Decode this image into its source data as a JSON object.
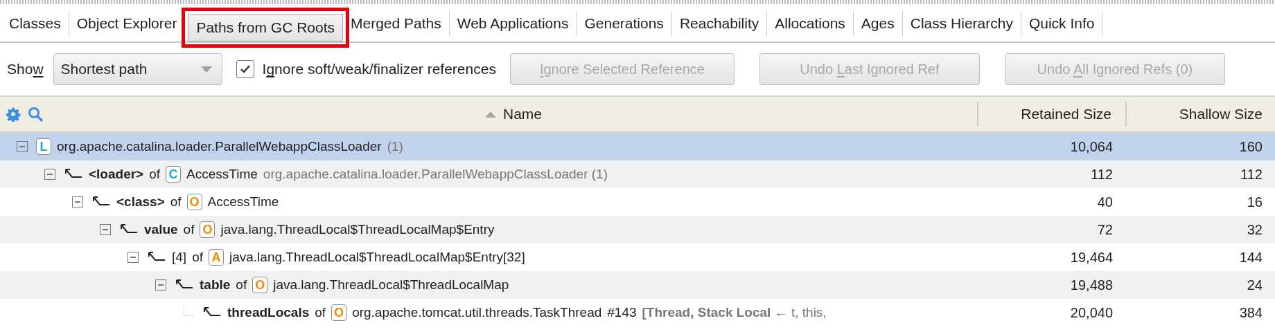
{
  "tabs": [
    {
      "label": "Classes",
      "selected": false,
      "highlighted": false
    },
    {
      "label": "Object Explorer",
      "selected": false,
      "highlighted": false
    },
    {
      "label": "Paths from GC Roots",
      "selected": true,
      "highlighted": true
    },
    {
      "label": "Merged Paths",
      "selected": false,
      "highlighted": false
    },
    {
      "label": "Web Applications",
      "selected": false,
      "highlighted": false
    },
    {
      "label": "Generations",
      "selected": false,
      "highlighted": false
    },
    {
      "label": "Reachability",
      "selected": false,
      "highlighted": false
    },
    {
      "label": "Allocations",
      "selected": false,
      "highlighted": false
    },
    {
      "label": "Ages",
      "selected": false,
      "highlighted": false
    },
    {
      "label": "Class Hierarchy",
      "selected": false,
      "highlighted": false
    },
    {
      "label": "Quick Info",
      "selected": false,
      "highlighted": false
    }
  ],
  "toolbar": {
    "show_label": [
      {
        "text": "Sho",
        "underlined": false
      },
      {
        "text": "w",
        "underlined": true
      }
    ],
    "show_dropdown": {
      "value": "Shortest path"
    },
    "ignore_checkbox": {
      "label": [
        {
          "text": "I",
          "underlined": false
        },
        {
          "text": "g",
          "underlined": true
        },
        {
          "text": "nore soft/weak/finalizer references",
          "underlined": false
        }
      ],
      "checked": true
    },
    "buttons": [
      {
        "label": [
          {
            "text": "I",
            "underlined": true
          },
          {
            "text": "gnore Selected Reference",
            "underlined": false
          }
        ],
        "disabled": true
      },
      {
        "label": [
          {
            "text": "Undo ",
            "underlined": false
          },
          {
            "text": "L",
            "underlined": true
          },
          {
            "text": "ast Ignored Ref",
            "underlined": false
          }
        ],
        "disabled": true
      },
      {
        "label": [
          {
            "text": "Undo ",
            "underlined": false
          },
          {
            "text": "A",
            "underlined": true
          },
          {
            "text": "ll Ignored Refs (0)",
            "underlined": false
          }
        ],
        "disabled": true
      }
    ]
  },
  "table": {
    "columns": [
      {
        "label": "Name",
        "sorted": true
      },
      {
        "label": "Retained Size",
        "sorted": false
      },
      {
        "label": "Shallow Size",
        "sorted": false
      }
    ],
    "rows": [
      {
        "badge": {
          "letter": "L",
          "color": "#1aa3e8"
        },
        "class_name": "org.apache.catalina.loader.ParallelWebappClassLoader",
        "note": "(1)",
        "retained": "10,064",
        "shallow": "160",
        "selected": true,
        "expanded": true,
        "children": [
          {
            "field": "<loader>",
            "field_bold": true,
            "of": "of",
            "badge": {
              "letter": "C",
              "color": "#1aa3e8"
            },
            "class_name": "AccessTime",
            "note": "org.apache.catalina.loader.ParallelWebappClassLoader (1)",
            "retained": "112",
            "shallow": "112",
            "selected": false,
            "expanded": true,
            "children": [
              {
                "field": "<class>",
                "field_bold": true,
                "of": "of",
                "badge": {
                  "letter": "O",
                  "color": "#f28a00"
                },
                "class_name": "AccessTime",
                "retained": "40",
                "shallow": "16",
                "selected": false,
                "expanded": true,
                "children": [
                  {
                    "field": "value",
                    "field_bold": true,
                    "of": "of",
                    "badge": {
                      "letter": "O",
                      "color": "#f28a00"
                    },
                    "class_name": "java.lang.ThreadLocal$ThreadLocalMap$Entry",
                    "retained": "72",
                    "shallow": "32",
                    "selected": false,
                    "expanded": true,
                    "children": [
                      {
                        "field": "[4]",
                        "field_bold": false,
                        "of": "of",
                        "badge": {
                          "letter": "A",
                          "color": "#f28a00"
                        },
                        "class_name": "java.lang.ThreadLocal$ThreadLocalMap$Entry[32]",
                        "retained": "19,464",
                        "shallow": "144",
                        "selected": false,
                        "expanded": true,
                        "children": [
                          {
                            "field": "table",
                            "field_bold": true,
                            "of": "of",
                            "badge": {
                              "letter": "O",
                              "color": "#f28a00"
                            },
                            "class_name": "java.lang.ThreadLocal$ThreadLocalMap",
                            "retained": "19,488",
                            "shallow": "24",
                            "selected": false,
                            "expanded": true,
                            "children": [
                              {
                                "field": "threadLocals",
                                "field_bold": true,
                                "of": "of",
                                "badge": {
                                  "letter": "O",
                                  "color": "#f28a00"
                                },
                                "class_name": "org.apache.tomcat.util.threads.TaskThread",
                                "detail": "#143",
                                "note": "**[Thread, Stack Local** ← t, this,",
                                "retained": "20,040",
                                "shallow": "384",
                                "selected": false
                              }
                            ]
                          }
                        ]
                      }
                    ]
                  }
                ]
              }
            ]
          }
        ]
      }
    ]
  }
}
